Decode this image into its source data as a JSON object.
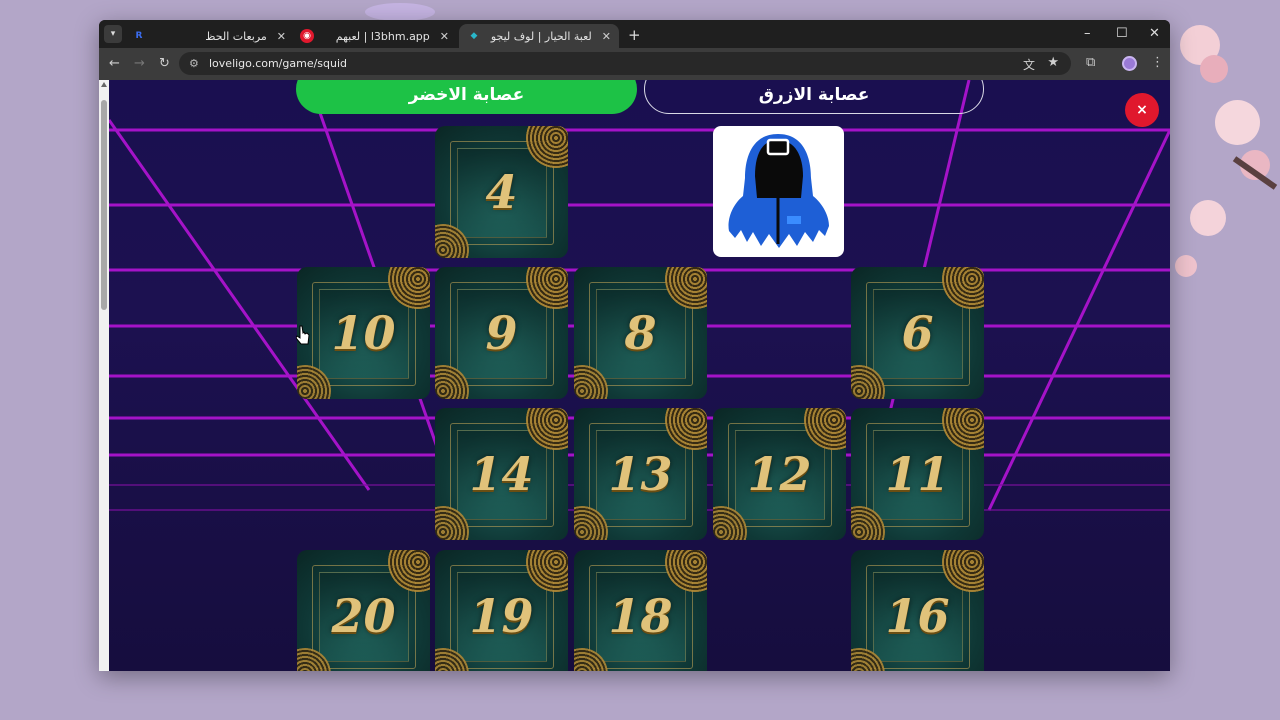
{
  "browser": {
    "tabs": [
      {
        "title": "مربعات الحظ",
        "icon": "rj-icon",
        "icon_color": "#3b6df0",
        "active": false
      },
      {
        "title": "l3bhm.app | لعبهم",
        "icon": "eye-icon",
        "icon_color": "#e0182d",
        "active": false
      },
      {
        "title": "لعبة الحيار | لوف ليجو يوفر أفضل",
        "icon": "loveligo-icon",
        "icon_color": "#29b6c9",
        "active": true
      }
    ],
    "url": "loveligo.com/game/squid"
  },
  "game": {
    "teams": {
      "green": "عصابة الاخضر",
      "blue": "عصابة الازرق"
    },
    "close_label": "×",
    "cards": [
      "4",
      "10",
      "9",
      "8",
      "6",
      "14",
      "13",
      "12",
      "11",
      "20",
      "19",
      "18",
      "16"
    ],
    "guard_image": "squid-game-guard-icon",
    "colors": {
      "team_green": "#1dc246",
      "close_red": "#e0182d",
      "card_gold": "#e0c27a",
      "grid_magenta": "#b414d6"
    }
  }
}
